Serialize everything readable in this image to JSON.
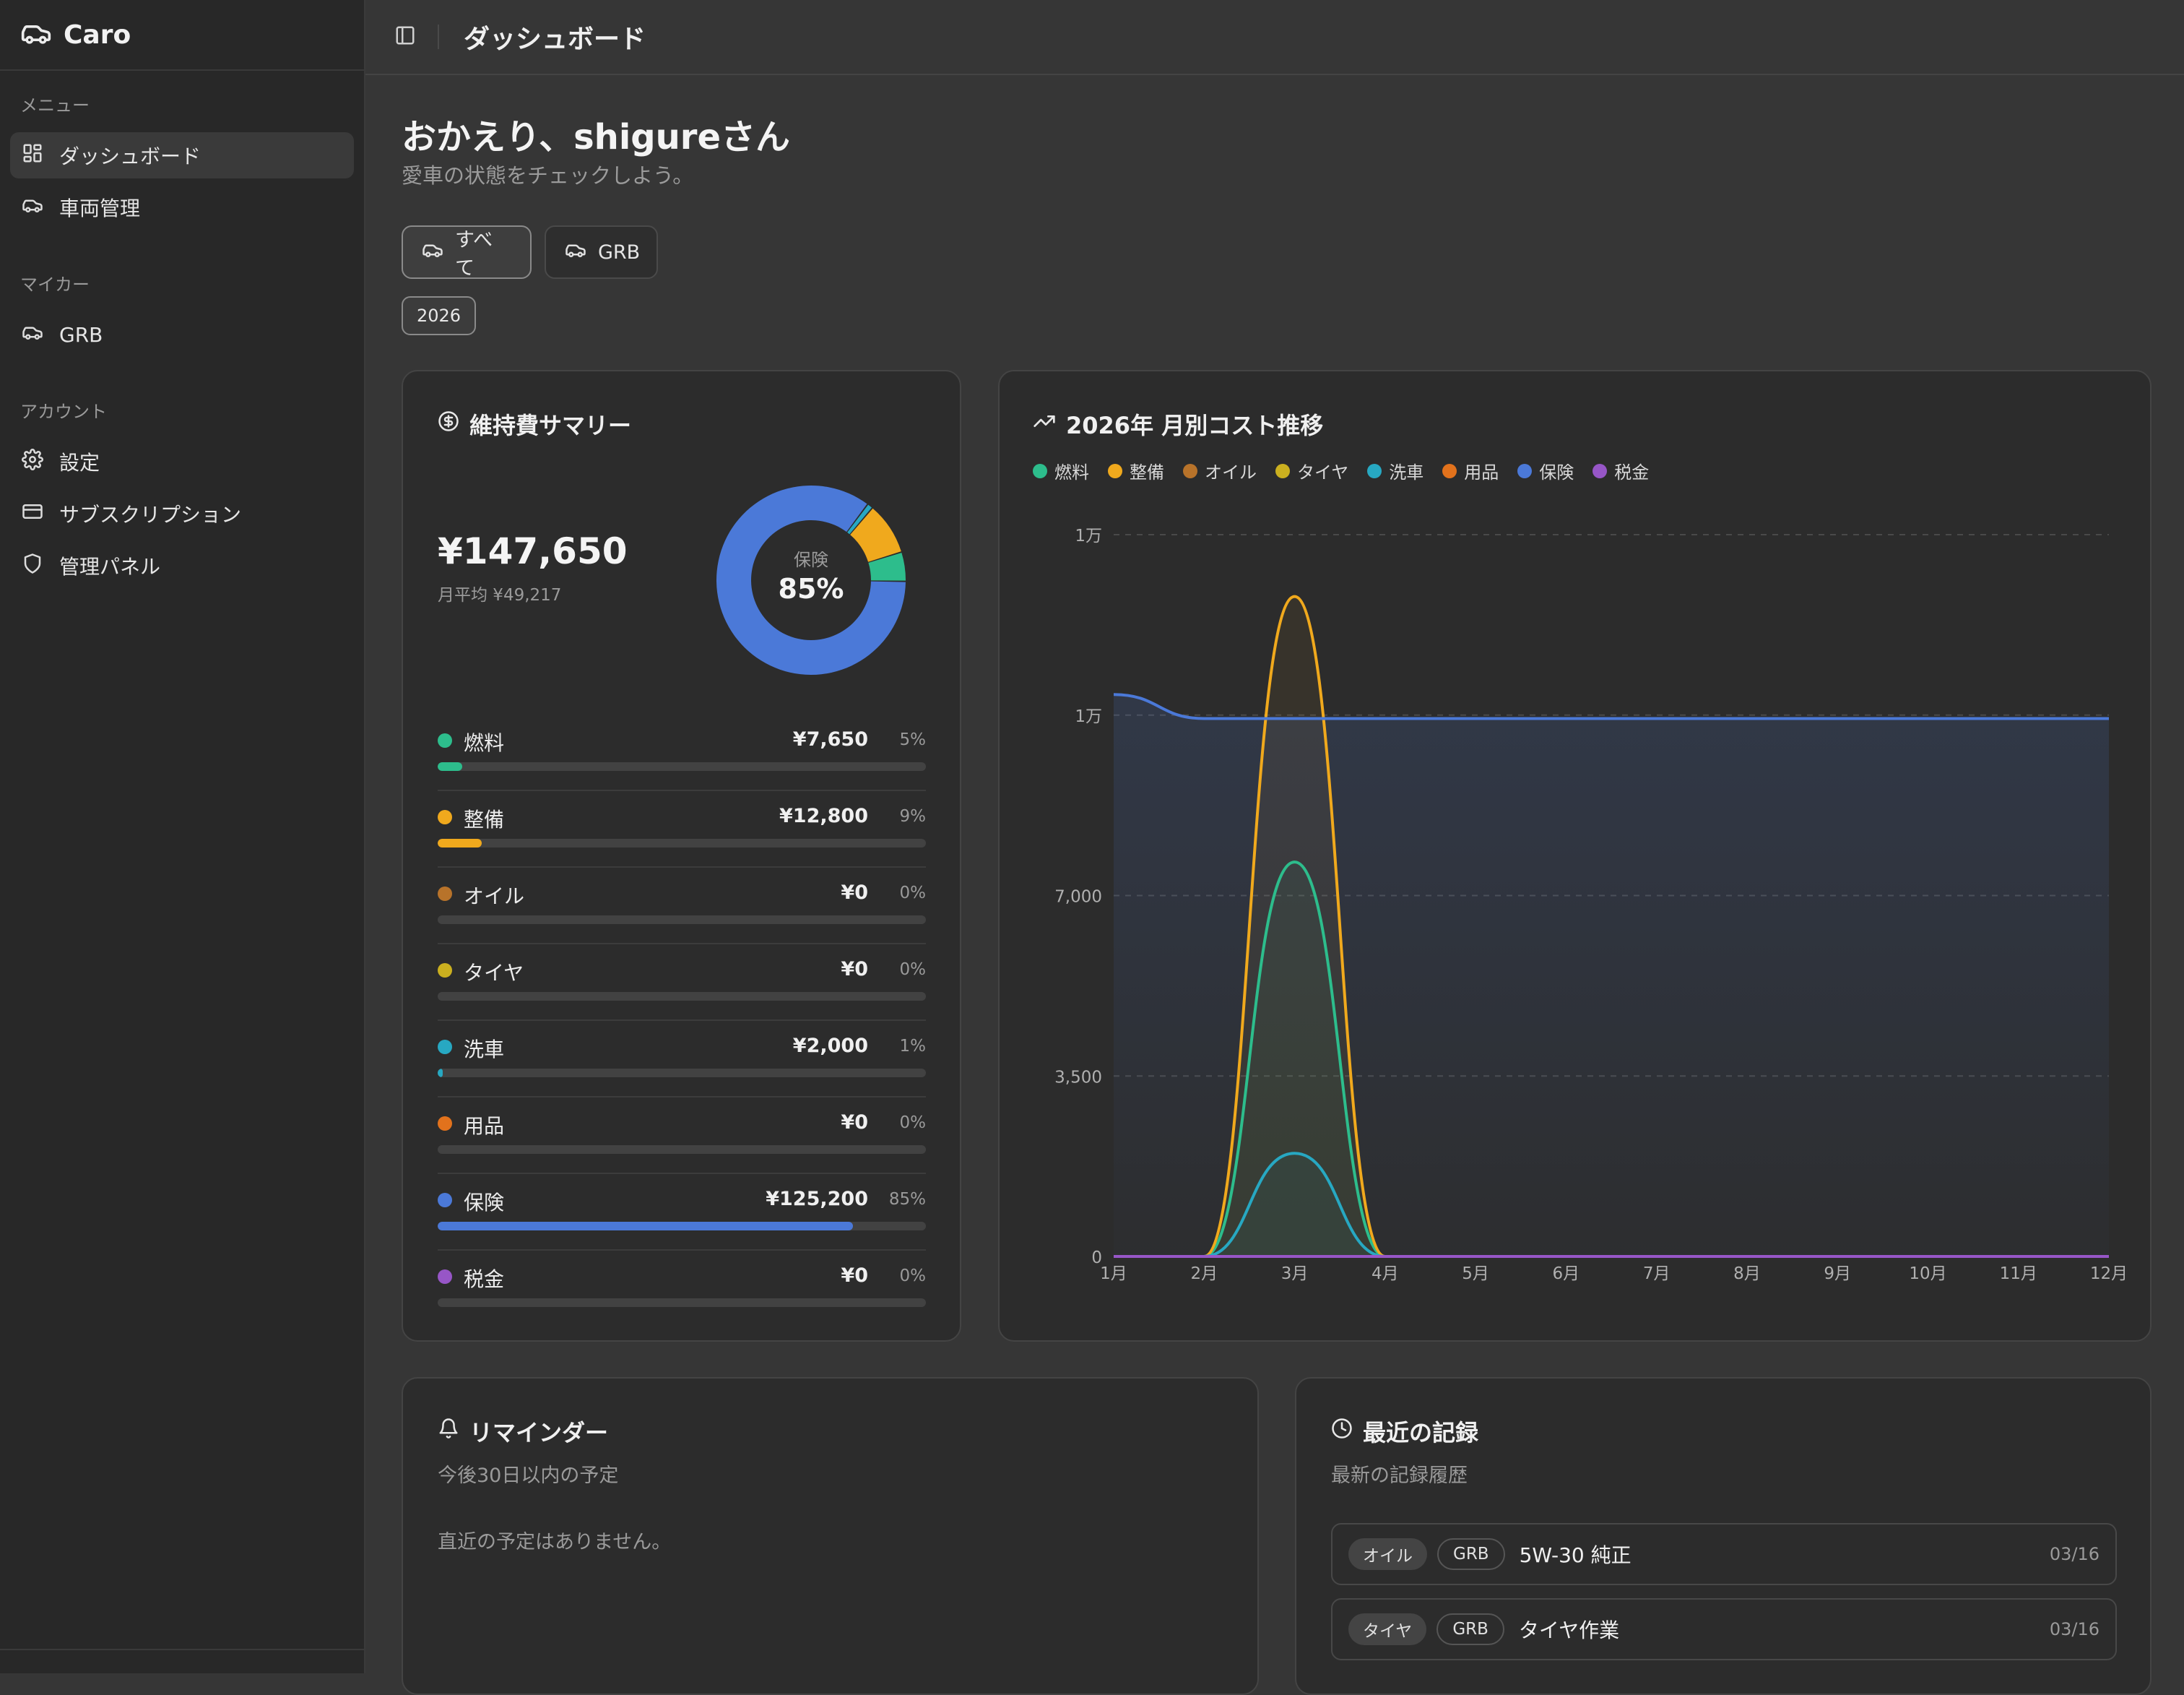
{
  "app": {
    "name": "Caro"
  },
  "sidebar": {
    "sections": [
      {
        "label": "メニュー",
        "items": [
          {
            "label": "ダッシュボード",
            "icon": "dashboard-icon",
            "active": true
          },
          {
            "label": "車両管理",
            "icon": "car-icon"
          }
        ]
      },
      {
        "label": "マイカー",
        "items": [
          {
            "label": "GRB",
            "icon": "car-icon"
          }
        ]
      },
      {
        "label": "アカウント",
        "items": [
          {
            "label": "設定",
            "icon": "gear-icon"
          },
          {
            "label": "サブスクリプション",
            "icon": "credit-card-icon"
          },
          {
            "label": "管理パネル",
            "icon": "shield-icon"
          }
        ]
      }
    ]
  },
  "header": {
    "title": "ダッシュボード"
  },
  "greeting": {
    "title": "おかえり、shigureさん",
    "subtitle": "愛車の状態をチェックしよう。"
  },
  "filters": {
    "all": "すべて",
    "grb": "GRB",
    "year": "2026"
  },
  "summary": {
    "title": "維持費サマリー",
    "total": "¥147,650",
    "monthly_avg": "月平均 ¥49,217",
    "donut_label": "保険",
    "donut_pct": "85%",
    "categories": [
      {
        "name": "燃料",
        "amount": "¥7,650",
        "pct": "5%",
        "share": 0.05,
        "color": "#2dbd8c"
      },
      {
        "name": "整備",
        "amount": "¥12,800",
        "pct": "9%",
        "share": 0.09,
        "color": "#f0a91d"
      },
      {
        "name": "オイル",
        "amount": "¥0",
        "pct": "0%",
        "share": 0,
        "color": "#b8732a"
      },
      {
        "name": "タイヤ",
        "amount": "¥0",
        "pct": "0%",
        "share": 0,
        "color": "#cbb01f"
      },
      {
        "name": "洗車",
        "amount": "¥2,000",
        "pct": "1%",
        "share": 0.01,
        "color": "#27a8c2"
      },
      {
        "name": "用品",
        "amount": "¥0",
        "pct": "0%",
        "share": 0,
        "color": "#e2721c"
      },
      {
        "name": "保険",
        "amount": "¥125,200",
        "pct": "85%",
        "share": 0.85,
        "color": "#4b79d8"
      },
      {
        "name": "税金",
        "amount": "¥0",
        "pct": "0%",
        "share": 0,
        "color": "#9756c7"
      }
    ]
  },
  "trend": {
    "title": "2026年 月別コスト推移"
  },
  "chart_data": {
    "type": "area",
    "title": "2026年 月別コスト推移",
    "categories": [
      "1月",
      "2月",
      "3月",
      "4月",
      "5月",
      "6月",
      "7月",
      "8月",
      "9月",
      "10月",
      "11月",
      "12月"
    ],
    "y_ticks": [
      "0",
      "3,500",
      "7,000",
      "1万",
      "1万"
    ],
    "y_tick_values": [
      0,
      3500,
      7000,
      10500,
      14000
    ],
    "ylim": [
      0,
      14000
    ],
    "legend": {
      "position": "top-left"
    },
    "grid": true,
    "series": [
      {
        "name": "燃料",
        "color": "#2dbd8c",
        "values": [
          0,
          0,
          7650,
          0,
          0,
          0,
          0,
          0,
          0,
          0,
          0,
          0
        ]
      },
      {
        "name": "整備",
        "color": "#f0a91d",
        "values": [
          0,
          0,
          12800,
          0,
          0,
          0,
          0,
          0,
          0,
          0,
          0,
          0
        ]
      },
      {
        "name": "オイル",
        "color": "#b8732a",
        "values": [
          0,
          0,
          0,
          0,
          0,
          0,
          0,
          0,
          0,
          0,
          0,
          0
        ]
      },
      {
        "name": "タイヤ",
        "color": "#cbb01f",
        "values": [
          0,
          0,
          0,
          0,
          0,
          0,
          0,
          0,
          0,
          0,
          0,
          0
        ]
      },
      {
        "name": "洗車",
        "color": "#27a8c2",
        "values": [
          0,
          0,
          2000,
          0,
          0,
          0,
          0,
          0,
          0,
          0,
          0,
          0
        ]
      },
      {
        "name": "用品",
        "color": "#e2721c",
        "values": [
          0,
          0,
          0,
          0,
          0,
          0,
          0,
          0,
          0,
          0,
          0,
          0
        ]
      },
      {
        "name": "保険",
        "color": "#4b79d8",
        "values": [
          10900,
          10433,
          10433,
          10433,
          10433,
          10433,
          10433,
          10433,
          10433,
          10433,
          10433,
          10433
        ]
      },
      {
        "name": "税金",
        "color": "#9756c7",
        "values": [
          0,
          0,
          0,
          0,
          0,
          0,
          0,
          0,
          0,
          0,
          0,
          0
        ]
      }
    ]
  },
  "reminders": {
    "title": "リマインダー",
    "subtitle": "今後30日以内の予定",
    "empty": "直近の予定はありません。"
  },
  "recent": {
    "title": "最近の記録",
    "subtitle": "最新の記録履歴",
    "items": [
      {
        "category": "オイル",
        "car": "GRB",
        "title": "5W-30 純正",
        "date": "03/16"
      },
      {
        "category": "タイヤ",
        "car": "GRB",
        "title": "タイヤ作業",
        "date": "03/16"
      }
    ]
  }
}
